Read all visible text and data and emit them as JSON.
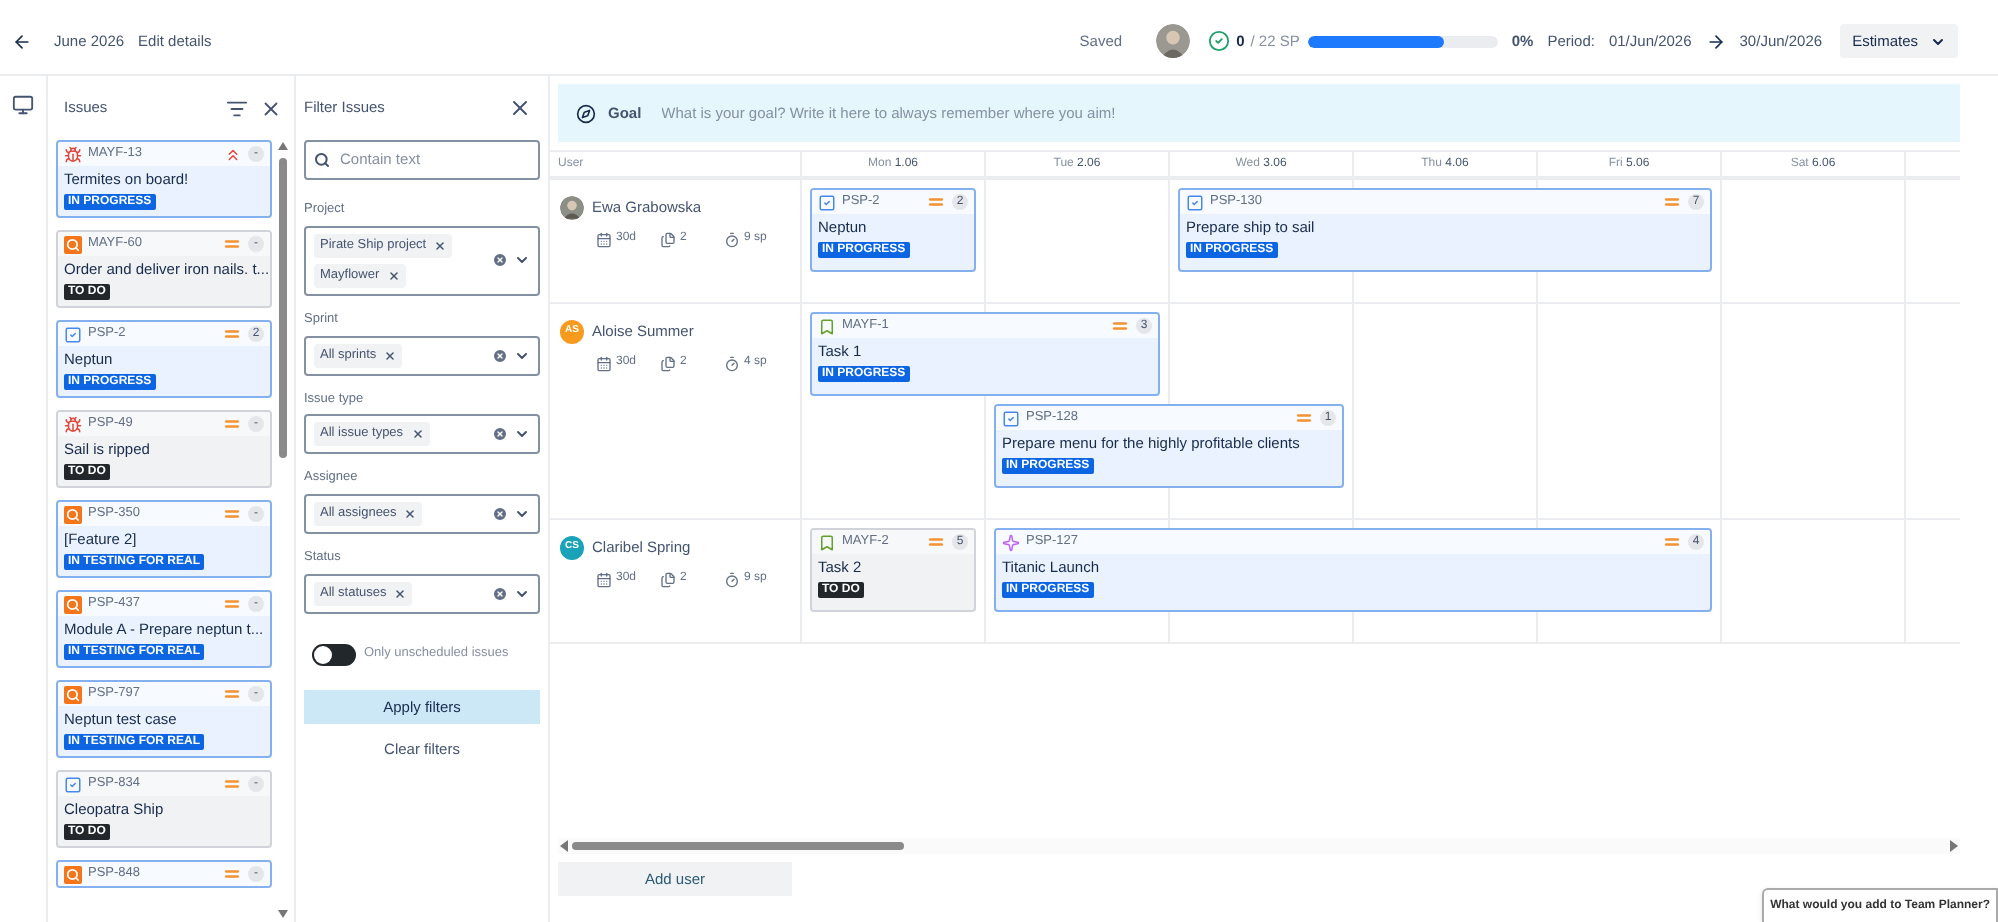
{
  "header": {
    "title": "June 2026",
    "edit_link": "Edit details",
    "save_status": "Saved",
    "progress": {
      "done": "0",
      "total": "/ 22 SP",
      "level": 0.72,
      "percent": "0%"
    },
    "period": {
      "label": "Period:",
      "start": "01/Jun/2026",
      "end": "30/Jun/2026"
    },
    "estimates_button": "Estimates"
  },
  "issues_panel": {
    "title": "Issues",
    "items": [
      {
        "kind": "bug",
        "key": "MAYF-13",
        "priority": {
          "kind": "highest"
        },
        "estimate": "-",
        "title": "Termites on board!",
        "status": {
          "label": "IN PROGRESS",
          "kind": "in_progress"
        }
      },
      {
        "kind": "research",
        "key": "MAYF-60",
        "priority": {
          "kind": "medium"
        },
        "estimate": "-",
        "title": "Order and deliver iron nails. t...",
        "status": {
          "label": "TO DO",
          "kind": "todo"
        }
      },
      {
        "kind": "task",
        "key": "PSP-2",
        "priority": {
          "kind": "medium"
        },
        "estimate": "2",
        "title": "Neptun",
        "status": {
          "label": "IN PROGRESS",
          "kind": "in_progress"
        }
      },
      {
        "kind": "bug",
        "key": "PSP-49",
        "priority": {
          "kind": "medium"
        },
        "estimate": "-",
        "title": "Sail is ripped",
        "status": {
          "label": "TO DO",
          "kind": "todo"
        }
      },
      {
        "kind": "research",
        "key": "PSP-350",
        "priority": {
          "kind": "medium"
        },
        "estimate": "-",
        "title": "[Feature 2]",
        "status": {
          "label": "IN TESTING FOR REAL",
          "kind": "in_testing"
        }
      },
      {
        "kind": "research",
        "key": "PSP-437",
        "priority": {
          "kind": "medium"
        },
        "estimate": "-",
        "title": "Module A - Prepare neptun t...",
        "status": {
          "label": "IN TESTING FOR REAL",
          "kind": "in_testing"
        }
      },
      {
        "kind": "research",
        "key": "PSP-797",
        "priority": {
          "kind": "medium"
        },
        "estimate": "-",
        "title": "Neptun test case",
        "status": {
          "label": "IN TESTING FOR REAL",
          "kind": "in_testing"
        }
      },
      {
        "kind": "task",
        "key": "PSP-834",
        "priority": {
          "kind": "medium"
        },
        "estimate": "-",
        "title": "Cleopatra Ship",
        "status": {
          "label": "TO DO",
          "kind": "todo"
        }
      },
      {
        "kind": "research",
        "key": "PSP-848",
        "priority": {
          "kind": "medium"
        },
        "estimate": "-"
      }
    ]
  },
  "filter_panel": {
    "title": "Filter Issues",
    "search_placeholder": "Contain text",
    "fields": [
      {
        "label": "Project",
        "chips": [
          "Pirate Ship project",
          "Mayflower"
        ]
      },
      {
        "label": "Sprint",
        "chips": [
          "All sprints"
        ]
      },
      {
        "label": "Issue type",
        "chips": [
          "All issue types"
        ]
      },
      {
        "label": "Assignee",
        "chips": [
          "All assignees"
        ]
      },
      {
        "label": "Status",
        "chips": [
          "All statuses"
        ]
      }
    ],
    "toggle": {
      "label": "Only unscheduled issues",
      "on": false
    },
    "apply_button": "Apply filters",
    "clear_button": "Clear filters"
  },
  "goal": {
    "label": "Goal",
    "placeholder": "What is your goal? Write it here to always remember where you aim!"
  },
  "calendar": {
    "user_column": "User",
    "days": [
      {
        "day": "Mon",
        "date": "1.06"
      },
      {
        "day": "Tue",
        "date": "2.06"
      },
      {
        "day": "Wed",
        "date": "3.06"
      },
      {
        "day": "Thu",
        "date": "4.06"
      },
      {
        "day": "Fri",
        "date": "5.06"
      },
      {
        "day": "Sat",
        "date": "6.06"
      }
    ],
    "rows": [
      {
        "name": "Ewa Grabowska",
        "avatar": {
          "kind": "photo"
        },
        "capacity": "30d",
        "issues": "2",
        "points": "9 sp",
        "lanes": [
          [
            {
              "kind": "task",
              "key": "PSP-2",
              "priority": {
                "kind": "medium"
              },
              "estimate": "2",
              "title": "Neptun",
              "status": {
                "label": "IN PROGRESS",
                "kind": "in_progress"
              },
              "schedule": [
                true
              ]
            },
            {
              "kind": "gap"
            },
            {
              "kind": "task",
              "key": "PSP-130",
              "priority": {
                "kind": "medium"
              },
              "estimate": "7",
              "title": "Prepare ship to sail",
              "status": {
                "label": "IN PROGRESS",
                "kind": "in_progress"
              },
              "schedule": [
                true,
                true,
                true
              ]
            }
          ]
        ]
      },
      {
        "name": "Aloise Summer",
        "avatar": {
          "kind": "initials",
          "initials": "AS",
          "color": "#f79a1e"
        },
        "capacity": "30d",
        "issues": "2",
        "points": "4 sp",
        "lanes": [
          [
            {
              "kind": "story",
              "key": "MAYF-1",
              "priority": {
                "kind": "medium"
              },
              "estimate": "3",
              "title": "Task 1",
              "status": {
                "label": "IN PROGRESS",
                "kind": "in_progress"
              },
              "schedule": [
                true,
                true
              ]
            }
          ],
          [
            {
              "kind": "gap"
            },
            {
              "kind": "task",
              "key": "PSP-128",
              "priority": {
                "kind": "medium"
              },
              "estimate": "1",
              "title": "Prepare menu for the highly profitable clients",
              "status": {
                "label": "IN PROGRESS",
                "kind": "in_progress"
              },
              "schedule": [
                true,
                true
              ]
            }
          ]
        ]
      },
      {
        "name": "Claribel Spring",
        "avatar": {
          "kind": "initials",
          "initials": "CS",
          "color": "#1aa3b8"
        },
        "capacity": "30d",
        "issues": "2",
        "points": "9 sp",
        "lanes": [
          [
            {
              "kind": "story",
              "key": "MAYF-2",
              "priority": {
                "kind": "medium"
              },
              "estimate": "5",
              "title": "Task 2",
              "status": {
                "label": "TO DO",
                "kind": "todo"
              },
              "schedule": [
                true
              ]
            },
            {
              "kind": "feature",
              "key": "PSP-127",
              "priority": {
                "kind": "medium"
              },
              "estimate": "4",
              "title": "Titanic Launch",
              "status": {
                "label": "IN PROGRESS",
                "kind": "in_progress"
              },
              "schedule": [
                true,
                true,
                true,
                true
              ]
            }
          ]
        ]
      }
    ]
  },
  "add_user_button": "Add user",
  "feedback": "What would you add to Team Planner?"
}
